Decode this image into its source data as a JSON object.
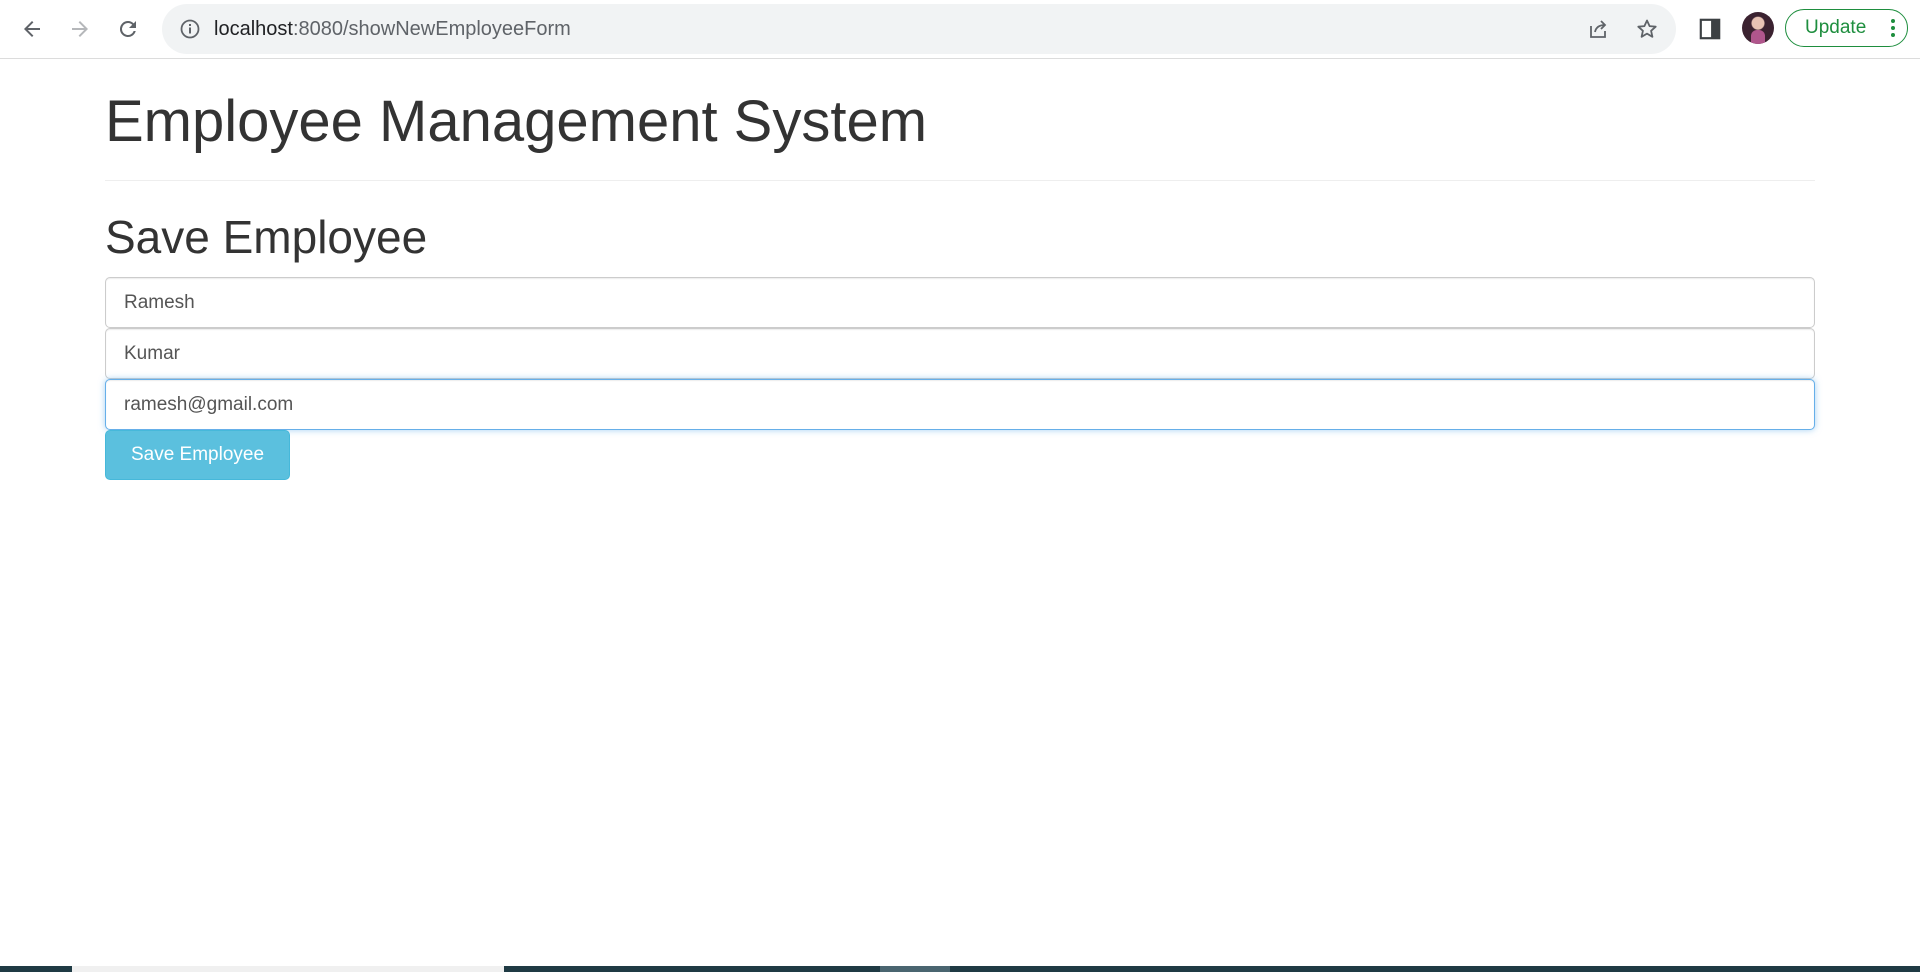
{
  "browser": {
    "url_host": "localhost",
    "url_rest": ":8080/showNewEmployeeForm",
    "update_label": "Update",
    "icons": {
      "back": "back-arrow-icon",
      "forward": "forward-arrow-icon",
      "reload": "reload-icon",
      "info": "site-info-icon",
      "share": "share-icon",
      "bookmark": "star-icon",
      "side_panel": "side-panel-icon",
      "profile": "avatar",
      "menu": "kebab-menu-icon"
    }
  },
  "page": {
    "title": "Employee Management System",
    "form_title": "Save Employee",
    "fields": {
      "first_name": "Ramesh",
      "last_name": "Kumar",
      "email": "ramesh@gmail.com"
    },
    "submit_label": "Save Employee"
  },
  "colors": {
    "button_bg": "#5bc0de",
    "focus_border": "#66afe9",
    "update_green": "#1e8e3e"
  }
}
